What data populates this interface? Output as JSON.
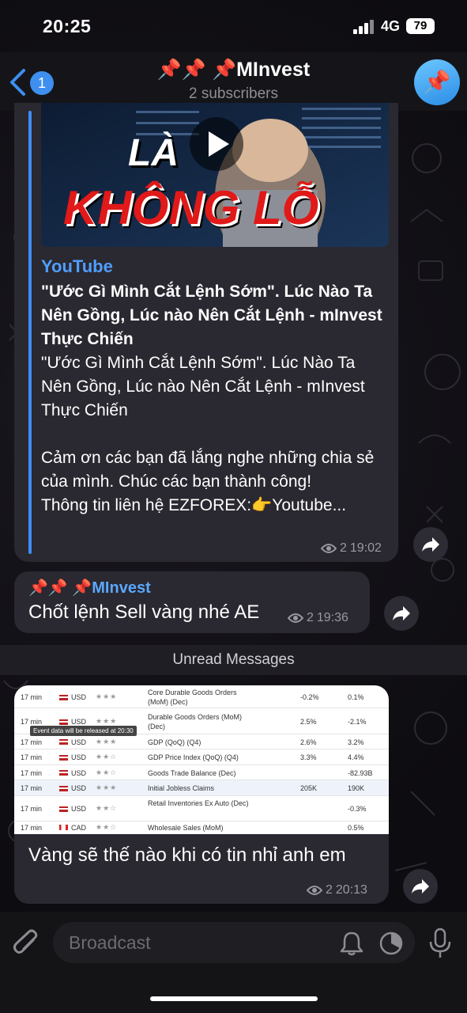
{
  "status": {
    "time": "20:25",
    "network": "4G",
    "battery": "79"
  },
  "header": {
    "back_badge": "1",
    "title": "📌📌 📌MInvest",
    "subtitle": "2 subscribers",
    "avatar": "📌"
  },
  "message1": {
    "thumb_text_top": "LÀ",
    "thumb_text_main": "KHÔNG LỖ",
    "site": "YouTube",
    "title": "\"Ước Gì Mình Cắt Lệnh Sớm\". Lúc Nào Ta Nên Gồng, Lúc nào Nên Cắt Lệnh - mInvest Thực Chiến",
    "description": "\"Ước Gì Mình Cắt Lệnh Sớm\". Lúc Nào Ta Nên Gồng, Lúc nào Nên Cắt Lệnh - mInvest Thực Chiến\n\nCảm ơn các bạn đã lắng nghe những chia sẻ của mình. Chúc các bạn thành công!\nThông tin liên hệ EZFOREX:👉Youtube...",
    "views": "2",
    "time": "19:02"
  },
  "message2": {
    "author": "📌📌 📌MInvest",
    "text": "Chốt lệnh Sell vàng nhé AE",
    "views": "2",
    "time": "19:36"
  },
  "unread_label": "Unread Messages",
  "message3": {
    "table": {
      "tooltip": "Event data will be released at 20:30",
      "rows": [
        {
          "time": "17 min",
          "currency": "USD",
          "event": "Core Durable Goods Orders (MoM) (Dec)",
          "forecast": "-0.2%",
          "previous": "0.1%"
        },
        {
          "time": "17 min",
          "currency": "USD",
          "event": "Durable Goods Orders (MoM) (Dec)",
          "forecast": "2.5%",
          "previous": "-2.1%"
        },
        {
          "time": "17 min",
          "currency": "USD",
          "event": "GDP (QoQ) (Q4)",
          "forecast": "2.6%",
          "previous": "3.2%"
        },
        {
          "time": "17 min",
          "currency": "USD",
          "event": "GDP Price Index (QoQ) (Q4)",
          "forecast": "3.3%",
          "previous": "4.4%"
        },
        {
          "time": "17 min",
          "currency": "USD",
          "event": "Goods Trade Balance (Dec)",
          "forecast": "",
          "previous": "-82.93B"
        },
        {
          "time": "17 min",
          "currency": "USD",
          "event": "Initial Jobless Claims",
          "forecast": "205K",
          "previous": "190K"
        },
        {
          "time": "17 min",
          "currency": "USD",
          "event": "Retail Inventories Ex Auto (Dec)",
          "forecast": "",
          "previous": "-0.3%"
        },
        {
          "time": "17 min",
          "currency": "CAD",
          "event": "Wholesale Sales (MoM)",
          "forecast": "",
          "previous": "0.5%"
        }
      ]
    },
    "text": "Vàng sẽ thế nào khi có tin nhỉ anh em",
    "views": "2",
    "time": "20:13"
  },
  "input": {
    "placeholder": "Broadcast"
  }
}
